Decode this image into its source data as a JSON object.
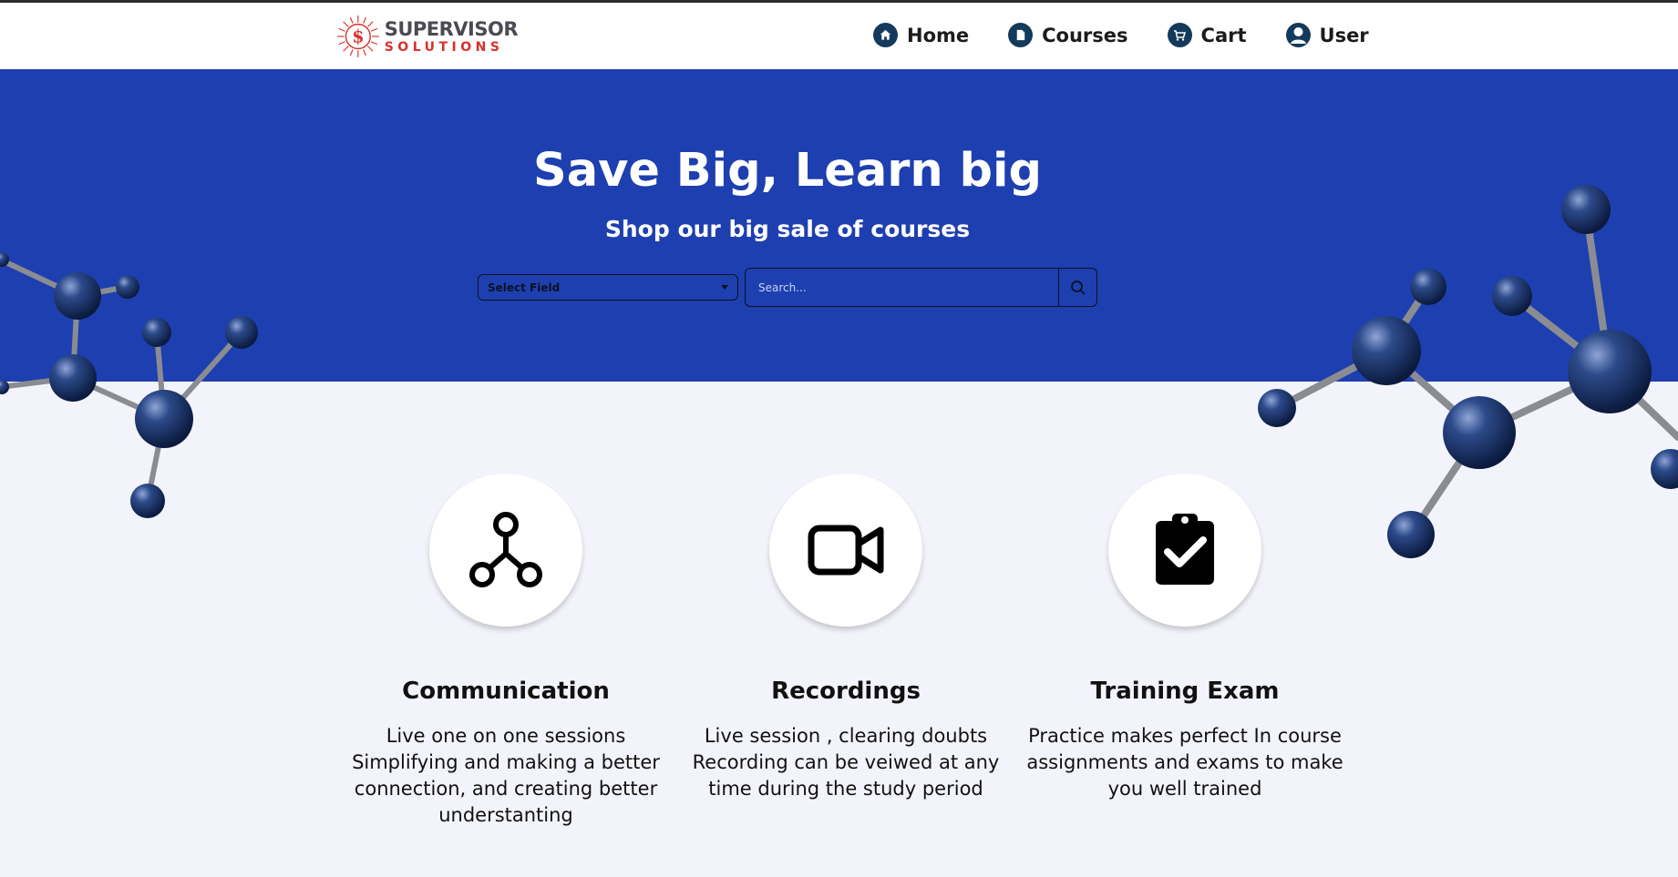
{
  "brand": {
    "logo_top": "SUPERVISOR",
    "logo_bottom": "SOLUTIONS",
    "colors": {
      "primary": "#1e3fb0",
      "logo_red": "#d8302b",
      "nav_icon": "#143a5b"
    }
  },
  "nav": {
    "items": [
      {
        "label": "Home",
        "icon": "home-icon"
      },
      {
        "label": "Courses",
        "icon": "document-icon"
      },
      {
        "label": "Cart",
        "icon": "cart-icon"
      },
      {
        "label": "User",
        "icon": "user-icon"
      }
    ]
  },
  "hero": {
    "title": "Save Big, Learn big",
    "subtitle": "Shop our big sale of courses",
    "select_field": "Select Field",
    "search_placeholder": "Search..."
  },
  "features": [
    {
      "icon": "communication-icon",
      "title": "Communication",
      "text": "Live one on one sessions Simplifying and making a better connection, and creating better understanting"
    },
    {
      "icon": "video-camera-icon",
      "title": "Recordings",
      "text": "Live session , clearing doubts Recording can be veiwed at any time during the study period"
    },
    {
      "icon": "clipboard-check-icon",
      "title": "Training Exam",
      "text": "Practice makes perfect In course assignments and exams to make you well trained"
    }
  ]
}
